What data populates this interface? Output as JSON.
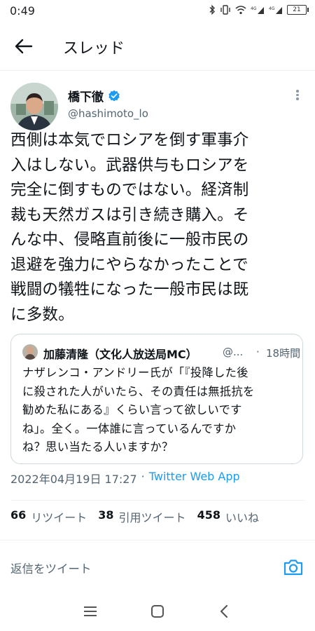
{
  "status_bar": {
    "time": "0:49",
    "battery": "21"
  },
  "app_bar": {
    "title": "スレッド"
  },
  "tweet": {
    "author_name": "橋下徹",
    "author_handle": "@hashimoto_lo",
    "verified": true,
    "text": "西側は本気でロシアを倒す軍事介\n入はしない。武器供与もロシアを\n完全に倒すものではない。経済制\n裁も天然ガスは引き続き購入。そ\nんな中、侵略直前後に一般市民の\n退避を強力にやらなかったことで\n戦闘の犠牲になった一般市民は既\nに多数。",
    "timestamp": "2022年04月19日 17:27",
    "separator": "·",
    "source": "Twitter Web App"
  },
  "quote": {
    "author_name": "加藤清隆（文化人放送局MC）",
    "author_handle": "@...",
    "separator": "·",
    "time": "18時間",
    "text": "ナザレンコ・アンドリー氏が「『投降した後\nに殺された人がいたら、その責任は無抵抗を\n勧めた私にある』くらい言って欲しいです\nね」。全く。一体誰に言っているんですか\nね？思い当たる人いますか？"
  },
  "stats": {
    "retweets_count": "66",
    "retweets_label": "リツイート",
    "quotes_count": "38",
    "quotes_label": "引用ツイート",
    "likes_count": "458",
    "likes_label": "いいね"
  },
  "reply": {
    "placeholder": "返信をツイート"
  },
  "colors": {
    "accent": "#1d9bf0",
    "text": "#0f1419",
    "secondary": "#536471"
  }
}
